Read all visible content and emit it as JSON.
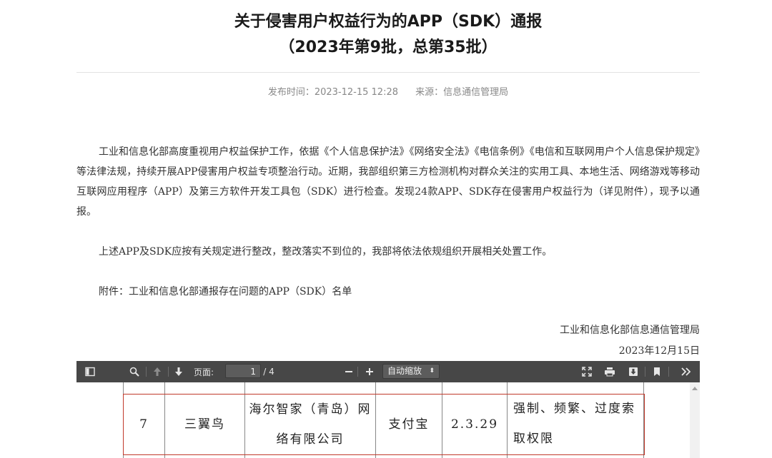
{
  "article": {
    "title_line1": "关于侵害用户权益行为的APP（SDK）通报",
    "title_line2": "（2023年第9批，总第35批）",
    "publish_time": "发布时间：2023-12-15 12:28",
    "source": "来源：信息通信管理局",
    "paragraph1": "工业和信息化部高度重视用户权益保护工作，依据《个人信息保护法》《网络安全法》《电信条例》《电信和互联网用户个人信息保护规定》等法律法规，持续开展APP侵害用户权益专项整治行动。近期，我部组织第三方检测机构对群众关注的实用工具、本地生活、网络游戏等移动互联网应用程序（APP）及第三方软件开发工具包（SDK）进行检查。发现24款APP、SDK存在侵害用户权益行为（详见附件），现予以通报。",
    "paragraph2": "上述APP及SDK应按有关规定进行整改，整改落实不到位的，我部将依法依规组织开展相关处置工作。",
    "paragraph3": "附件：工业和信息化部通报存在问题的APP（SDK）名单",
    "signature_org": "工业和信息化部信息通信管理局",
    "signature_date": "2023年12月15日"
  },
  "pdf_viewer": {
    "page_label": "页面:",
    "page_current": "1",
    "page_total": "/ 4",
    "zoom_value": "自动缩放",
    "icons": [
      "sidebar-toggle-icon",
      "search-icon",
      "up-arrow-icon",
      "down-arrow-icon",
      "zoom-out-icon",
      "zoom-in-icon",
      "fullscreen-icon",
      "print-icon",
      "download-icon",
      "bookmark-icon",
      "more-tools-icon"
    ]
  },
  "pdf_table": {
    "row": {
      "index": "7",
      "app_name": "三翼鸟",
      "developer_line1": "海尔智家（青岛）网",
      "developer_line2": "络有限公司",
      "store": "支付宝",
      "version": "2.3.29",
      "issue_line1": "强制、频繁、过度索",
      "issue_line2": "取权限"
    },
    "colors": {
      "highlight_border": "#c0392b"
    }
  }
}
